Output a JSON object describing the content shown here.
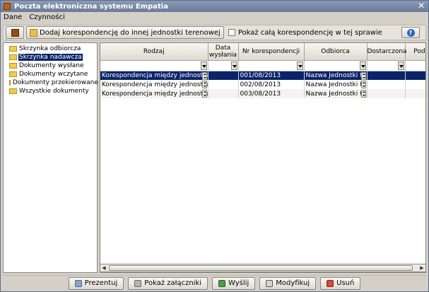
{
  "window": {
    "title": "Poczta elektroniczna systemu Empatia",
    "close_label": "✕"
  },
  "menu": {
    "items": [
      "Dane",
      "Czynności"
    ]
  },
  "toolbar": {
    "add_label": "Dodaj korespondencję do innej jednostki terenowej",
    "show_all_label": "Pokaż całą korespondencję w tej sprawie",
    "help_label": "?"
  },
  "tree": {
    "items": [
      {
        "label": "Skrzynka odbiorcza"
      },
      {
        "label": "Skrzynka nadawcza"
      },
      {
        "label": "Dokumenty wysłane"
      },
      {
        "label": "Dokumenty wczytane"
      },
      {
        "label": "Dokumenty przekierowane"
      },
      {
        "label": "Wszystkie dokumenty"
      }
    ],
    "selected": "Skrzynka nadawcza"
  },
  "grid": {
    "columns": [
      "Rodzaj",
      "Data wysłania",
      "Nr korespondencji",
      "Odbiorca",
      "Dostarczona",
      "Podpi"
    ],
    "rows": [
      {
        "rodzaj": "Korespondencja między jednostkami",
        "data": "",
        "nr": "001/08/2013",
        "odbiorca": "Nazwa Jednostki tes",
        "dostarczona": "",
        "podpis": ""
      },
      {
        "rodzaj": "Korespondencja między jednostkami",
        "data": "",
        "nr": "002/08/2013",
        "odbiorca": "Nazwa Jednostki tes",
        "dostarczona": "",
        "podpis": ""
      },
      {
        "rodzaj": "Korespondencja między jednostkami",
        "data": "",
        "nr": "003/08/2013",
        "odbiorca": "Nazwa Jednostki tes",
        "dostarczona": "",
        "podpis": ""
      }
    ],
    "selected_row": 0
  },
  "footer": {
    "buttons": [
      "Prezentuj",
      "Pokaż załączniki",
      "Wyślij",
      "Modyfikuj",
      "Usuń"
    ]
  },
  "icons": [
    "app-icon",
    "book-icon",
    "folder-add-icon",
    "help-icon",
    "folder-icon",
    "present-icon",
    "attachment-icon",
    "send-icon",
    "modify-icon",
    "delete-icon"
  ]
}
